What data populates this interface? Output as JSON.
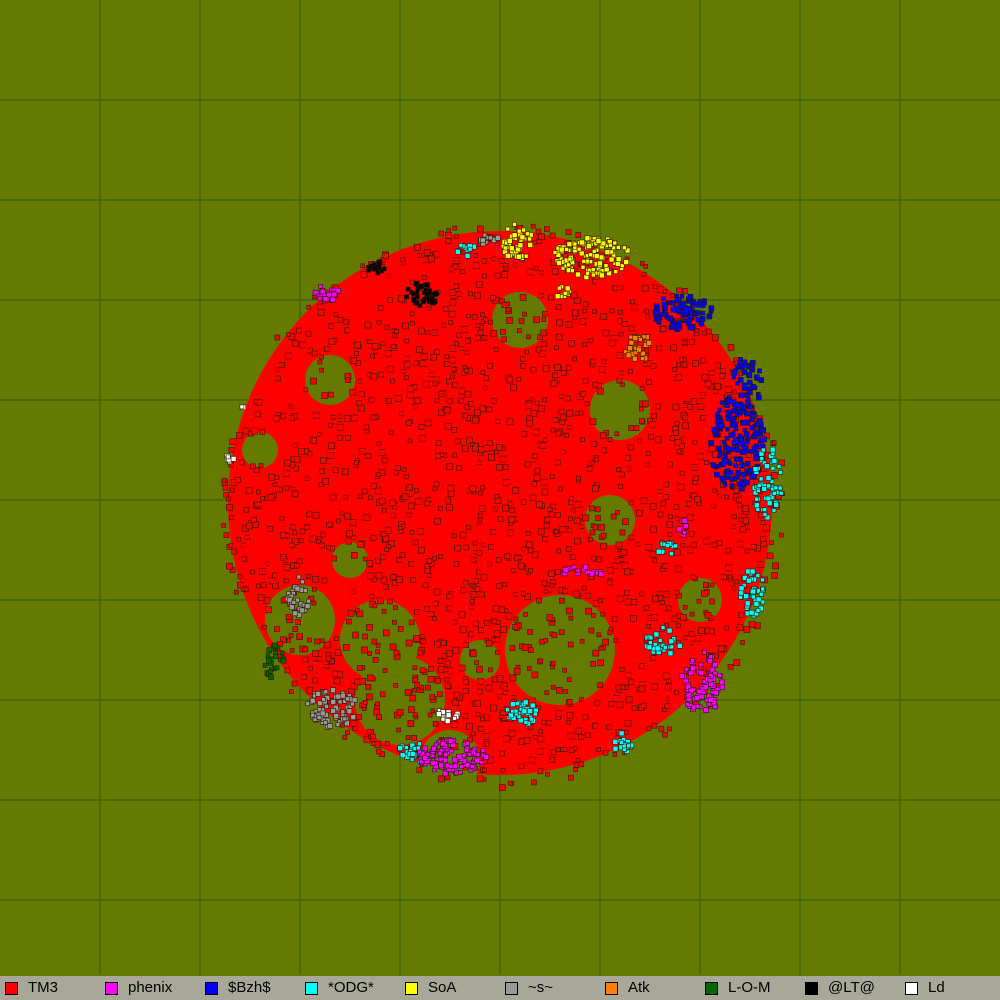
{
  "map": {
    "background_color": "#657a00",
    "grid_color": "#2f5a12",
    "tile_border_color": "#2a1a00"
  },
  "legend": {
    "items": [
      {
        "label": "TM3",
        "color": "#ff0000"
      },
      {
        "label": "phenix",
        "color": "#ff00ff"
      },
      {
        "label": "$Bzh$",
        "color": "#0000ff"
      },
      {
        "label": "*ODG*",
        "color": "#00ffff"
      },
      {
        "label": "SoA",
        "color": "#ffff00"
      },
      {
        "label": "~s~",
        "color": "#999999"
      },
      {
        "label": "Atk",
        "color": "#ff8000"
      },
      {
        "label": "L-O-M",
        "color": "#006600"
      },
      {
        "label": "@LT@",
        "color": "#000000"
      },
      {
        "label": "Ld",
        "color": "#ffffff"
      }
    ]
  }
}
